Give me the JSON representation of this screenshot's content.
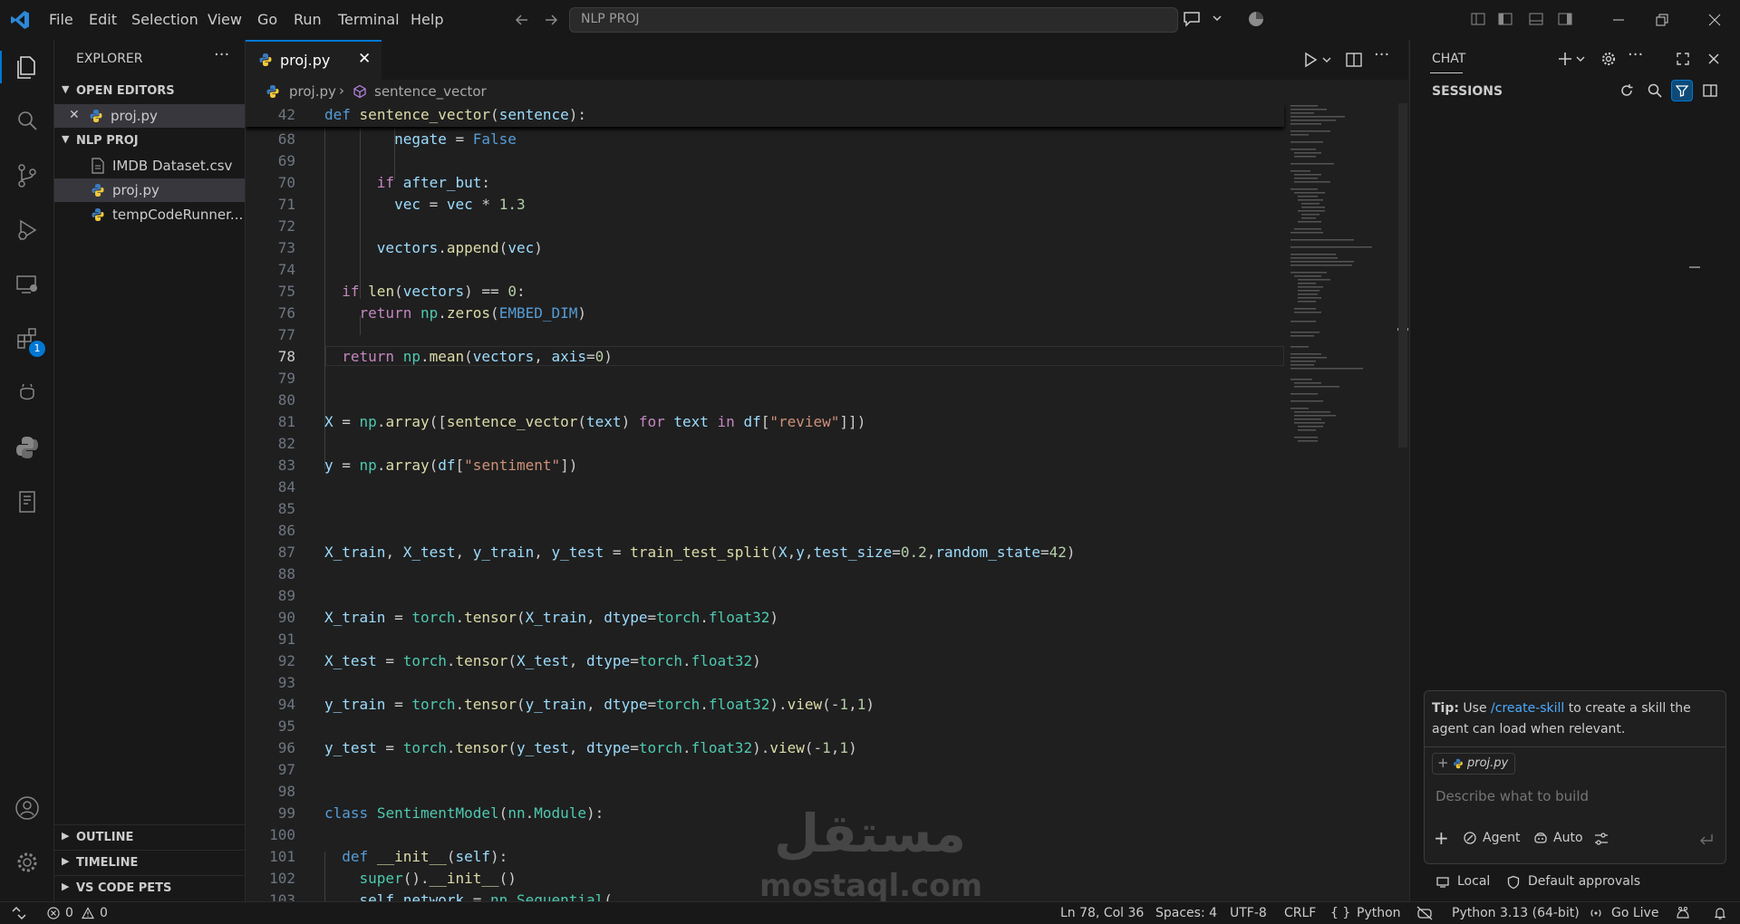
{
  "titlebar": {
    "menu": [
      "File",
      "Edit",
      "Selection",
      "View",
      "Go",
      "Run",
      "Terminal",
      "Help"
    ],
    "search_text": "NLP PROJ"
  },
  "activitybar": {
    "icons": [
      "explorer-icon",
      "search-icon",
      "source-control-icon",
      "run-debug-icon",
      "remote-explorer-icon",
      "extensions-icon",
      "testing-icon",
      "python-icon",
      "notebook-icon",
      "account-icon",
      "settings-icon"
    ],
    "extensions_badge": "1"
  },
  "sidebar": {
    "title": "EXPLORER",
    "open_editors_label": "OPEN EDITORS",
    "open_editor_file": "proj.py",
    "project_label": "NLP PROJ",
    "files": [
      "IMDB Dataset.csv",
      "proj.py",
      "tempCodeRunner..."
    ],
    "outline_label": "OUTLINE",
    "timeline_label": "TIMELINE",
    "vscode_pets_label": "VS CODE PETS"
  },
  "editor": {
    "tab_label": "proj.py",
    "breadcrumb_file": "proj.py",
    "breadcrumb_symbol": "sentence_vector",
    "sticky_line_number": "42",
    "current_line": "78"
  },
  "chat": {
    "title": "CHAT",
    "sessions_label": "SESSIONS",
    "tip_prefix": "Tip:",
    "tip_use": " Use ",
    "tip_link": "/create-skill",
    "tip_rest": " to create a skill the agent can load when relevant.",
    "context_file": "proj.py",
    "input_placeholder": "Describe what to build",
    "agent_label": "Agent",
    "auto_label": "Auto",
    "local_label": "Local",
    "approvals_label": "Default approvals"
  },
  "statusbar": {
    "errors": "0",
    "warnings": "0",
    "position": "Ln 78, Col 36",
    "spaces": "Spaces: 4",
    "encoding": "UTF-8",
    "eol": "CRLF",
    "language": "Python",
    "interpreter": "Python 3.13 (64-bit)",
    "golive": "Go Live"
  },
  "watermark": {
    "arabic": "مستقل",
    "latin": "mostaql.com"
  },
  "colors": {
    "accent": "#0078d4",
    "keyword": "#c586c0",
    "function": "#dcdcaa",
    "variable": "#9cdcfe",
    "number": "#b5cea8",
    "string": "#ce9178",
    "class": "#4ec9b0"
  }
}
